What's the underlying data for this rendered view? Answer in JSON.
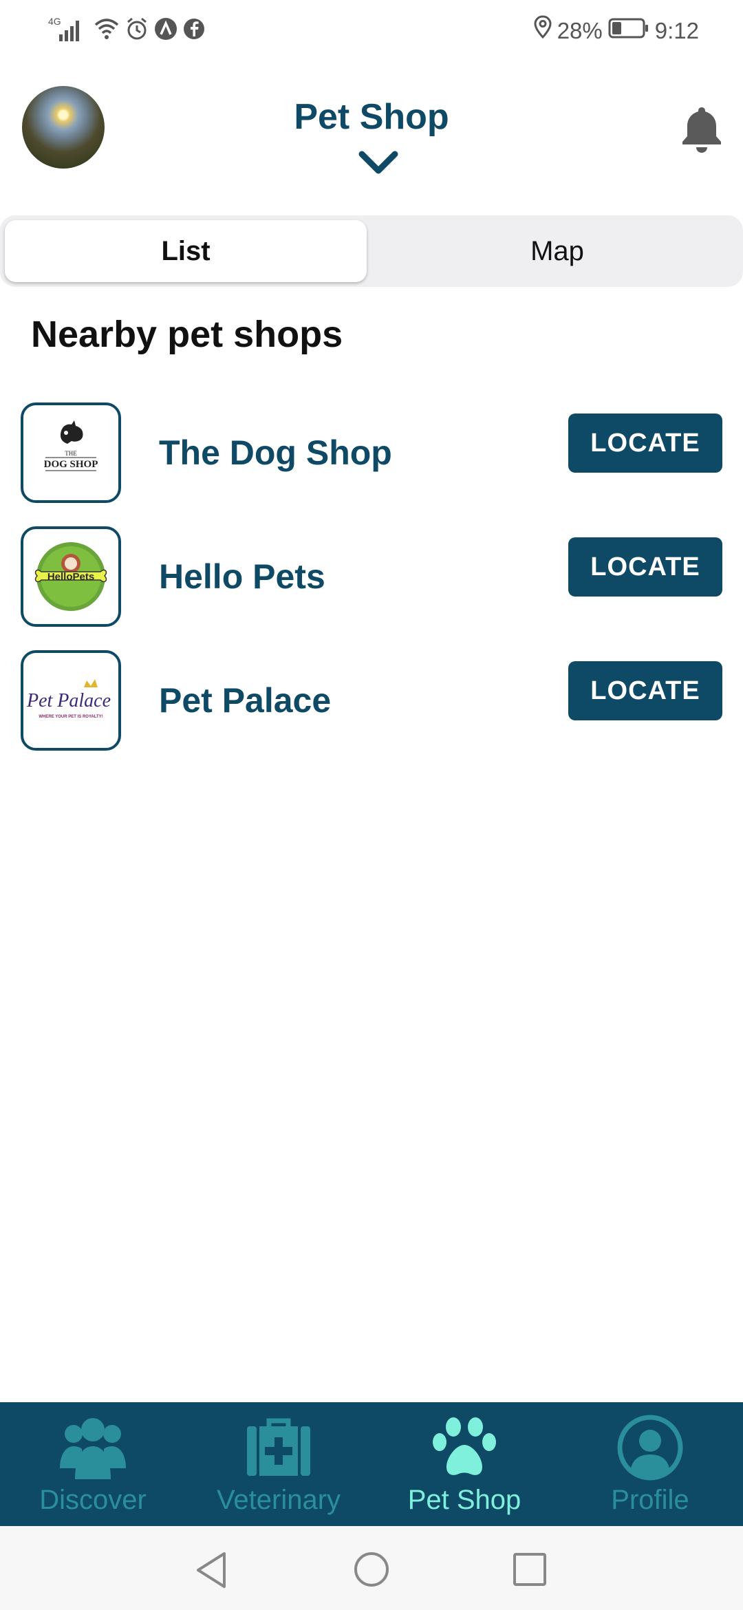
{
  "status_bar": {
    "network": "4G",
    "battery_percent": "28%",
    "time": "9:12"
  },
  "header": {
    "title": "Pet Shop"
  },
  "tabs": {
    "list_label": "List",
    "map_label": "Map",
    "selected": "List"
  },
  "section_title": "Nearby pet shops",
  "shops": [
    {
      "name": "The Dog Shop",
      "logo_text_top": "THE",
      "logo_text": "DOG SHOP",
      "button": "LOCATE"
    },
    {
      "name": "Hello Pets",
      "logo_text": "HelloPets",
      "button": "LOCATE"
    },
    {
      "name": "Pet Palace",
      "logo_text": "Pet Palace",
      "logo_tagline": "WHERE YOUR PET IS ROYALTY!",
      "button": "LOCATE"
    }
  ],
  "bottom_nav": [
    {
      "label": "Discover",
      "icon": "users-icon"
    },
    {
      "label": "Veterinary",
      "icon": "medical-kit-icon"
    },
    {
      "label": "Pet Shop",
      "icon": "paw-icon",
      "active": true
    },
    {
      "label": "Profile",
      "icon": "profile-icon"
    }
  ],
  "colors": {
    "primary": "#0e4a66",
    "nav_inactive": "#2a8f9a",
    "nav_active": "#7ff0dc",
    "segment_bg": "#efeff1"
  }
}
